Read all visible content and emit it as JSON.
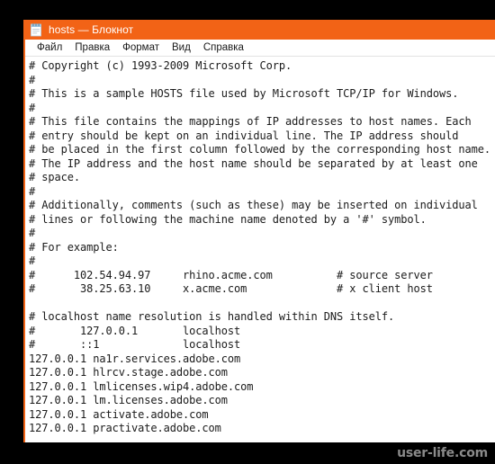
{
  "desktop": {
    "background_color": "#000000"
  },
  "window": {
    "title": "hosts — Блокнот",
    "accent_color": "#f26316",
    "icon": "notepad-icon",
    "menu": [
      {
        "label": "Файл"
      },
      {
        "label": "Правка"
      },
      {
        "label": "Формат"
      },
      {
        "label": "Вид"
      },
      {
        "label": "Справка"
      }
    ]
  },
  "editor": {
    "content": "# Copyright (c) 1993-2009 Microsoft Corp.\n#\n# This is a sample HOSTS file used by Microsoft TCP/IP for Windows.\n#\n# This file contains the mappings of IP addresses to host names. Each\n# entry should be kept on an individual line. The IP address should\n# be placed in the first column followed by the corresponding host name.\n# The IP address and the host name should be separated by at least one\n# space.\n#\n# Additionally, comments (such as these) may be inserted on individual\n# lines or following the machine name denoted by a '#' symbol.\n#\n# For example:\n#\n#      102.54.94.97     rhino.acme.com          # source server\n#       38.25.63.10     x.acme.com              # x client host\n\n# localhost name resolution is handled within DNS itself.\n#       127.0.0.1       localhost\n#       ::1             localhost\n127.0.0.1 na1r.services.adobe.com\n127.0.0.1 hlrcv.stage.adobe.com\n127.0.0.1 lmlicenses.wip4.adobe.com\n127.0.0.1 lm.licenses.adobe.com\n127.0.0.1 activate.adobe.com\n127.0.0.1 practivate.adobe.com"
  },
  "watermark": {
    "text": "user-life.com"
  }
}
